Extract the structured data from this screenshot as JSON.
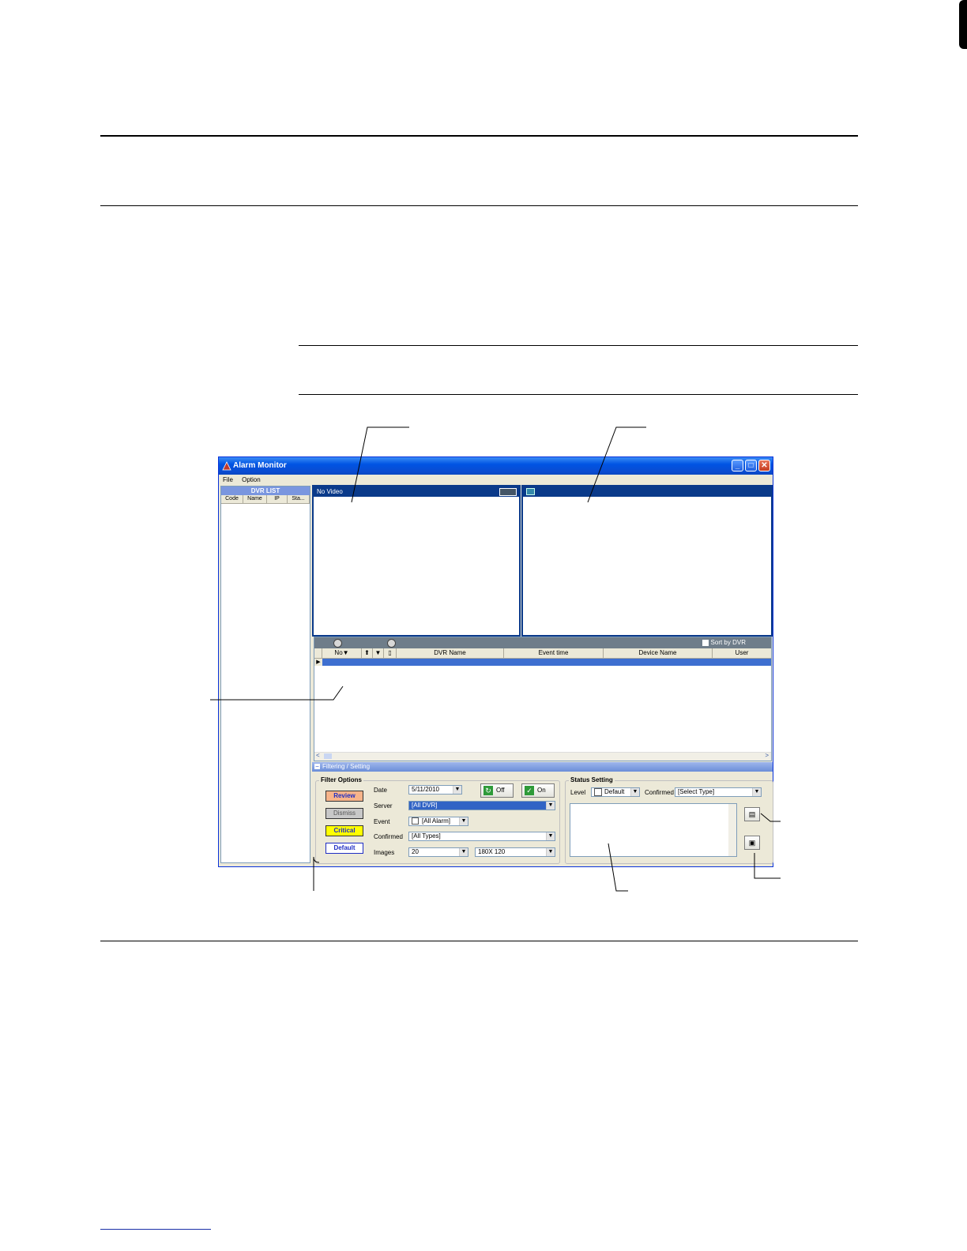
{
  "window": {
    "title": "Alarm Monitor",
    "menu": [
      "File",
      "Option"
    ],
    "controls": [
      "minimize-icon",
      "maximize-icon",
      "close-icon"
    ]
  },
  "dvr_list": {
    "header": "DVR LIST",
    "columns": [
      "Code",
      "Name",
      "IP",
      "Sta..."
    ]
  },
  "video_left": {
    "label": "No Video"
  },
  "event_list": {
    "sort_label": "Sort by DVR",
    "columns": [
      "No▼",
      "",
      "",
      "",
      "DVR Name",
      "Event time",
      "Device Name",
      "User"
    ],
    "column_icons": [
      "pin-icon",
      "filter-icon",
      "page-icon"
    ],
    "scroll_left": "<",
    "scroll_right": ">"
  },
  "filtering_bar": {
    "minus": "−",
    "label": "Filtering / Setting"
  },
  "filter_options": {
    "title": "Filter Options",
    "buttons": [
      {
        "label": "Review",
        "bg": "#f7b48a",
        "color": "#1f2ec4"
      },
      {
        "label": "Dismiss",
        "bg": "#c8c8c8",
        "color": "#555555"
      },
      {
        "label": "Critical",
        "bg": "#ffff00",
        "color": "#1f2ec4"
      },
      {
        "label": "Default",
        "bg": "#ffffff",
        "color": "#1f2ec4"
      }
    ],
    "date_label": "Date",
    "date_value": "5/11/2010",
    "off_label": "Off",
    "on_label": "On",
    "server_label": "Server",
    "server_value": "[All DVR]",
    "event_label": "Event",
    "event_value": "[All Alarm]",
    "confirmed_label": "Confirmed",
    "confirmed_value": "[All Types]",
    "images_label": "Images",
    "images_value": "20",
    "image_size": "180X 120"
  },
  "status_setting": {
    "title": "Status Setting",
    "level_label": "Level",
    "level_value": "Default",
    "confirmed_label": "Confirmed",
    "confirmed_value": "[Select Type]",
    "note_button_icon": "note-icon",
    "save_button_icon": "save-icon"
  }
}
